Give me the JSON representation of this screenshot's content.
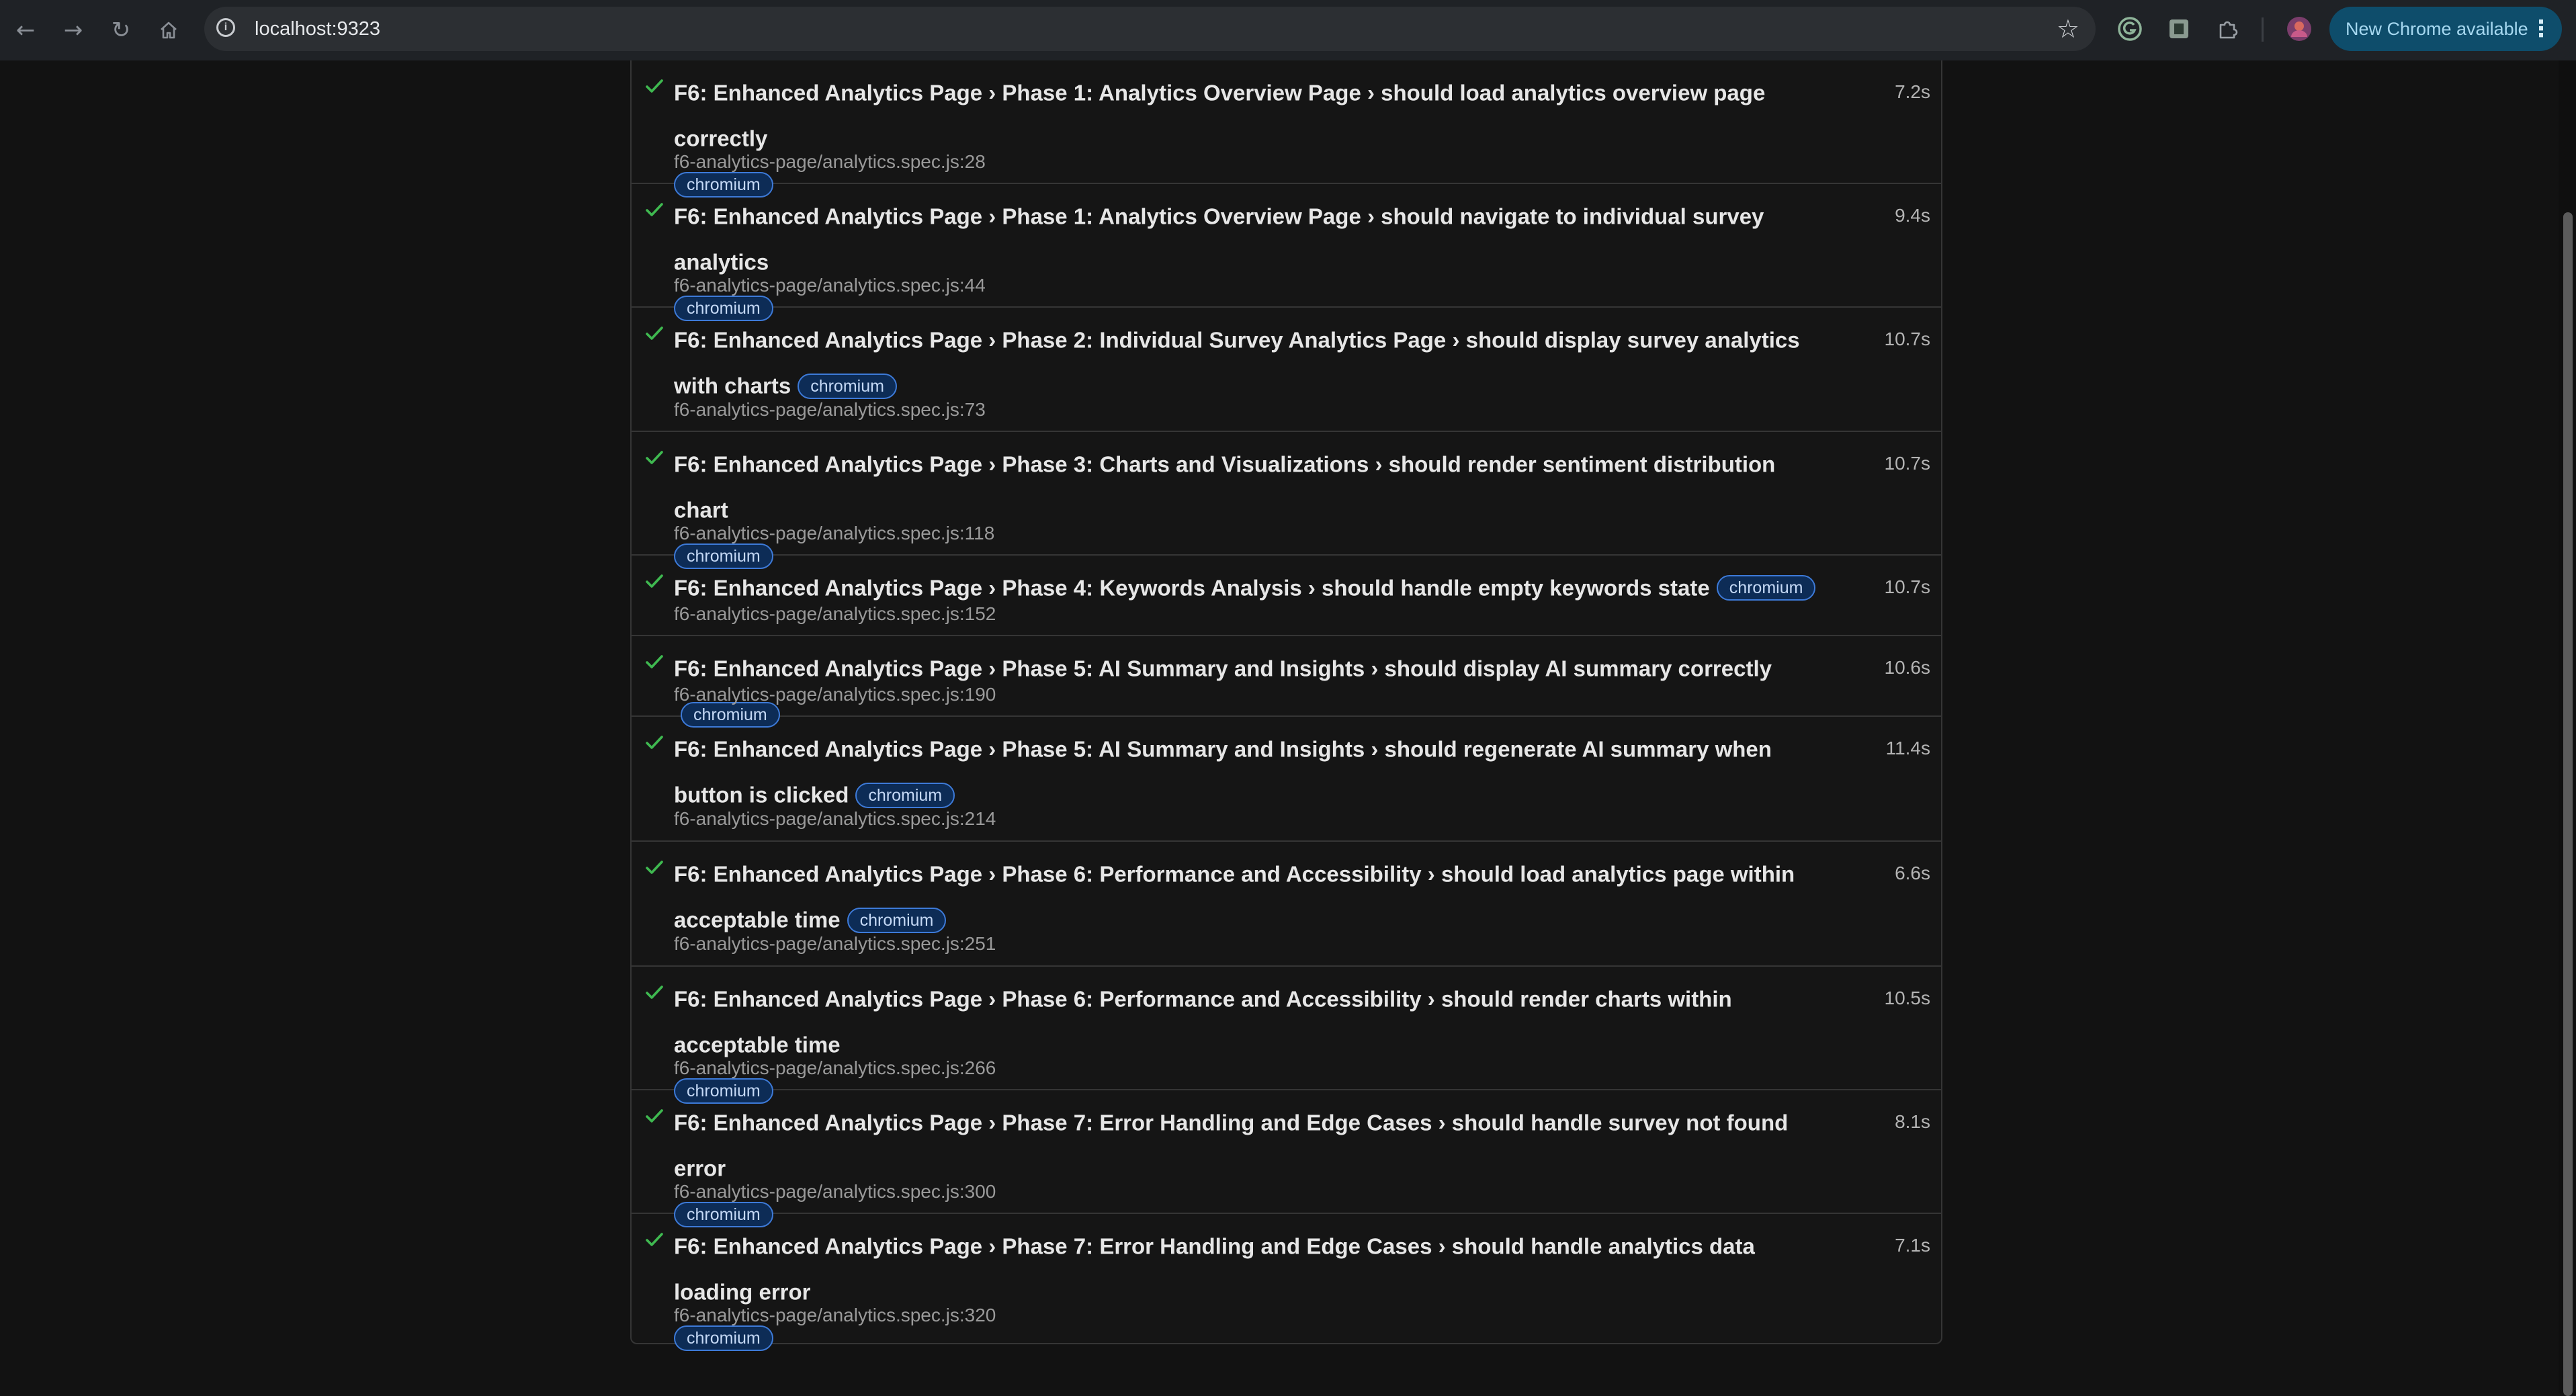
{
  "browser": {
    "url": "localhost:9323",
    "update_label": "New Chrome available",
    "nav_icons": [
      "back-arrow-icon",
      "forward-arrow-icon",
      "reload-icon",
      "home-icon"
    ],
    "accent_update": "#0e4d6b"
  },
  "report": {
    "tag_label": "chromium",
    "status_color": "#3fb950",
    "tests": [
      {
        "title": "F6: Enhanced Analytics Page › Phase 1: Analytics Overview Page › should load analytics overview page correctly",
        "file": "f6-analytics-page/analytics.spec.js:28",
        "duration": "7.2s",
        "status": "passed"
      },
      {
        "title": "F6: Enhanced Analytics Page › Phase 1: Analytics Overview Page › should navigate to individual survey analytics",
        "file": "f6-analytics-page/analytics.spec.js:44",
        "duration": "9.4s",
        "status": "passed"
      },
      {
        "title": "F6: Enhanced Analytics Page › Phase 2: Individual Survey Analytics Page › should display survey analytics with charts",
        "file": "f6-analytics-page/analytics.spec.js:73",
        "duration": "10.7s",
        "status": "passed"
      },
      {
        "title": "F6: Enhanced Analytics Page › Phase 3: Charts and Visualizations › should render sentiment distribution chart",
        "file": "f6-analytics-page/analytics.spec.js:118",
        "duration": "10.7s",
        "status": "passed"
      },
      {
        "title": "F6: Enhanced Analytics Page › Phase 4: Keywords Analysis › should handle empty keywords state",
        "file": "f6-analytics-page/analytics.spec.js:152",
        "duration": "10.7s",
        "status": "passed"
      },
      {
        "title": "F6: Enhanced Analytics Page › Phase 5: AI Summary and Insights › should display AI summary correctly",
        "file": "f6-analytics-page/analytics.spec.js:190",
        "duration": "10.6s",
        "status": "passed"
      },
      {
        "title": "F6: Enhanced Analytics Page › Phase 5: AI Summary and Insights › should regenerate AI summary when button is clicked",
        "file": "f6-analytics-page/analytics.spec.js:214",
        "duration": "11.4s",
        "status": "passed"
      },
      {
        "title": "F6: Enhanced Analytics Page › Phase 6: Performance and Accessibility › should load analytics page within acceptable time",
        "file": "f6-analytics-page/analytics.spec.js:251",
        "duration": "6.6s",
        "status": "passed"
      },
      {
        "title": "F6: Enhanced Analytics Page › Phase 6: Performance and Accessibility › should render charts within acceptable time",
        "file": "f6-analytics-page/analytics.spec.js:266",
        "duration": "10.5s",
        "status": "passed"
      },
      {
        "title": "F6: Enhanced Analytics Page › Phase 7: Error Handling and Edge Cases › should handle survey not found error",
        "file": "f6-analytics-page/analytics.spec.js:300",
        "duration": "8.1s",
        "status": "passed"
      },
      {
        "title": "F6: Enhanced Analytics Page › Phase 7: Error Handling and Edge Cases › should handle analytics data loading error",
        "file": "f6-analytics-page/analytics.spec.js:320",
        "duration": "7.1s",
        "status": "passed"
      }
    ]
  }
}
